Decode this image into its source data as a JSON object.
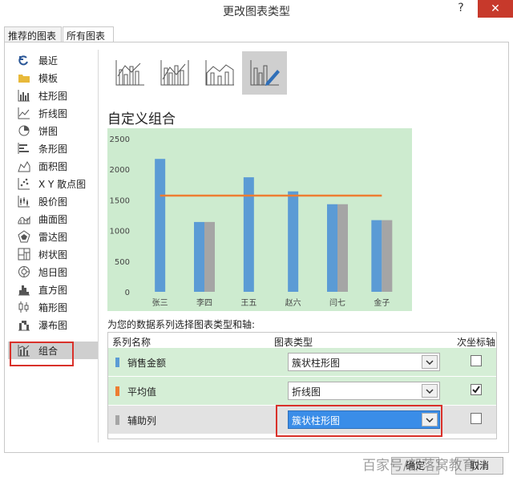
{
  "window": {
    "title": "更改图表类型",
    "help": "?",
    "close": "✕"
  },
  "tabs": [
    {
      "label": "推荐的图表"
    },
    {
      "label": "所有图表"
    }
  ],
  "sidebar": {
    "items": [
      {
        "label": "最近",
        "icon": "recent-icon"
      },
      {
        "label": "模板",
        "icon": "folder-icon"
      },
      {
        "label": "柱形图",
        "icon": "column-chart-icon"
      },
      {
        "label": "折线图",
        "icon": "line-chart-icon"
      },
      {
        "label": "饼图",
        "icon": "pie-chart-icon"
      },
      {
        "label": "条形图",
        "icon": "bar-chart-icon"
      },
      {
        "label": "面积图",
        "icon": "area-chart-icon"
      },
      {
        "label": "X Y 散点图",
        "icon": "scatter-chart-icon"
      },
      {
        "label": "股价图",
        "icon": "stock-chart-icon"
      },
      {
        "label": "曲面图",
        "icon": "surface-chart-icon"
      },
      {
        "label": "雷达图",
        "icon": "radar-chart-icon"
      },
      {
        "label": "树状图",
        "icon": "treemap-chart-icon"
      },
      {
        "label": "旭日图",
        "icon": "sunburst-chart-icon"
      },
      {
        "label": "直方图",
        "icon": "histogram-chart-icon"
      },
      {
        "label": "箱形图",
        "icon": "box-chart-icon"
      },
      {
        "label": "瀑布图",
        "icon": "waterfall-chart-icon"
      },
      {
        "label": "组合",
        "icon": "combo-chart-icon"
      }
    ],
    "active_index": 16
  },
  "section_title": "自定义组合",
  "colors": {
    "blue": "#5b9bd5",
    "orange": "#ed7d31",
    "gray": "#a5a5a5",
    "chart_bg": "#cdebcf",
    "highlight": "#3a8de8",
    "red_outline": "#d9312a"
  },
  "chart_data": {
    "type": "bar",
    "categories": [
      "张三",
      "李四",
      "王五",
      "赵六",
      "闫七",
      "金子"
    ],
    "series": [
      {
        "values": [
          2170,
          1140,
          1870,
          1640,
          1430,
          1170
        ],
        "color": "#5b9bd5"
      },
      {
        "values": [
          null,
          1140,
          null,
          null,
          1430,
          1170
        ],
        "color": "#a5a5a5"
      },
      {
        "type": "line",
        "values": [
          1570,
          1570,
          1570,
          1570,
          1570,
          1570
        ],
        "color": "#ed7d31"
      }
    ],
    "ylim": [
      0,
      2500
    ],
    "yticks": [
      0,
      500,
      1000,
      1500,
      2000,
      2500
    ],
    "grid": false
  },
  "instruction": "为您的数据系列选择图表类型和轴:",
  "table": {
    "headers": {
      "name": "系列名称",
      "type": "图表类型",
      "secondary": "次坐标轴"
    },
    "rows": [
      {
        "name": "销售金额",
        "type": "簇状柱形图",
        "secondary": false,
        "color": "#5b9bd5"
      },
      {
        "name": "平均值",
        "type": "折线图",
        "secondary": true,
        "color": "#ed7d31"
      },
      {
        "name": "辅助列",
        "type": "簇状柱形图",
        "secondary": false,
        "color": "#a5a5a5"
      }
    ]
  },
  "buttons": {
    "ok": "确定",
    "cancel": "取消"
  },
  "watermark": "百家号/部落窝教育H"
}
